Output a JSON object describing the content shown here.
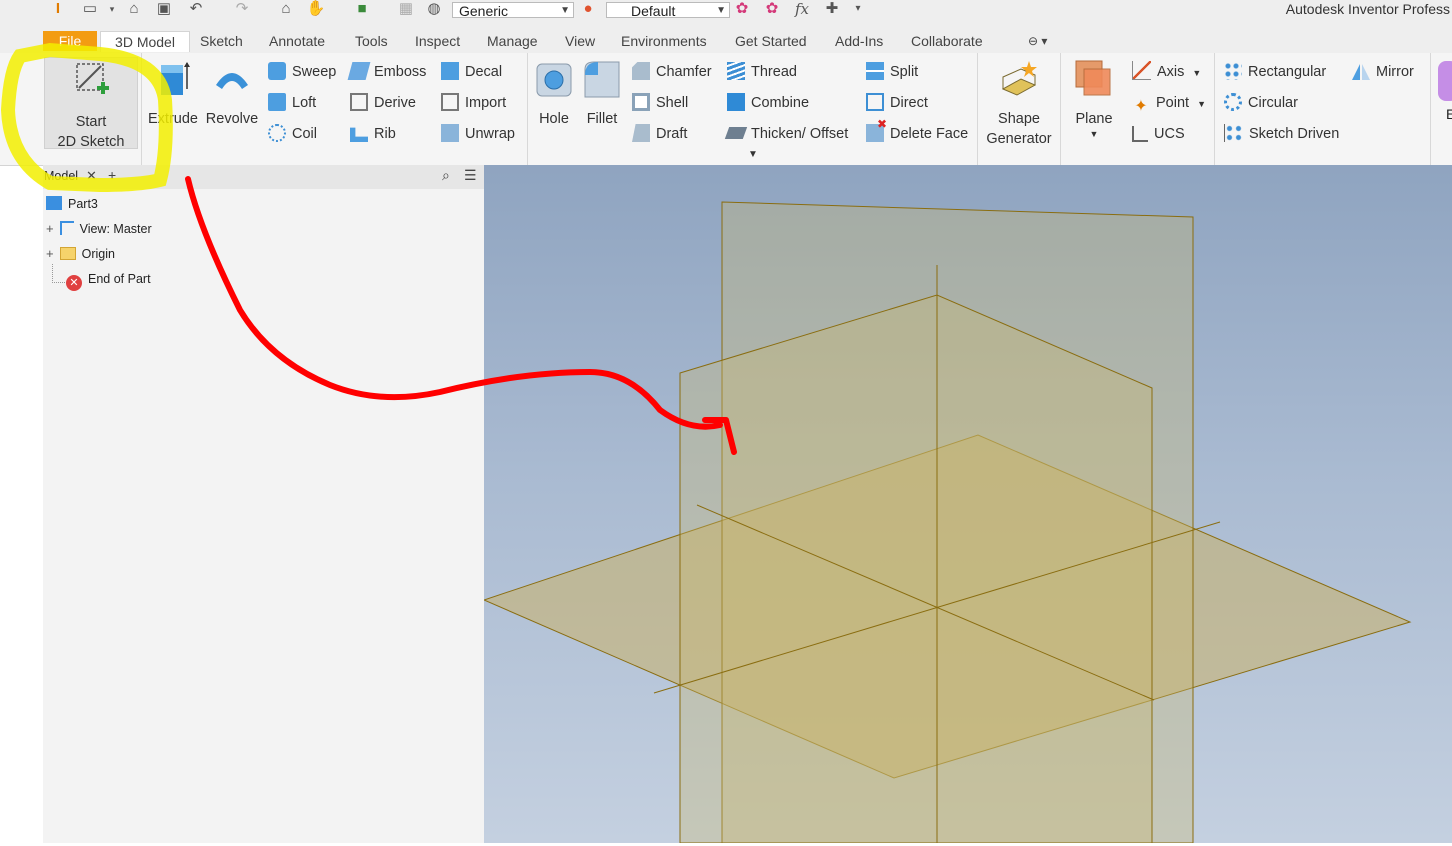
{
  "qat": {
    "material": "Generic",
    "appearance": "Default",
    "fx": "fx"
  },
  "app_title": "Autodesk Inventor Profess",
  "tabs": [
    "File",
    "3D Model",
    "Sketch",
    "Annotate",
    "Tools",
    "Inspect",
    "Manage",
    "View",
    "Environments",
    "Get Started",
    "Add-Ins",
    "Collaborate"
  ],
  "ribbon": {
    "start_sketch": {
      "line1": "Start",
      "line2": "2D Sketch"
    },
    "extrude": "Extrude",
    "revolve": "Revolve",
    "sweep": "Sweep",
    "loft": "Loft",
    "coil": "Coil",
    "emboss": "Emboss",
    "derive": "Derive",
    "rib": "Rib",
    "decal": "Decal",
    "import": "Import",
    "unwrap": "Unwrap",
    "hole": "Hole",
    "fillet": "Fillet",
    "chamfer": "Chamfer",
    "shell": "Shell",
    "draft": "Draft",
    "thread": "Thread",
    "combine": "Combine",
    "thicken": "Thicken/ Offset",
    "split": "Split",
    "direct": "Direct",
    "delete_face": "Delete Face",
    "shape_gen": {
      "line1": "Shape",
      "line2": "Generator"
    },
    "plane": "Plane",
    "axis": "Axis",
    "point": "Point",
    "ucs": "UCS",
    "rectangular": "Rectangular",
    "circular": "Circular",
    "sketch_driven": "Sketch Driven",
    "mirror": "Mirror",
    "cut_letter": "E"
  },
  "browser": {
    "tab": "Model",
    "items": [
      {
        "label": "Part3"
      },
      {
        "label": "View: Master"
      },
      {
        "label": "Origin"
      },
      {
        "label": "End of Part"
      }
    ]
  },
  "colors": {
    "highlight": "#f2ef00",
    "annotation_arrow": "#ff0000",
    "file_tab": "#f39c12",
    "plane_outline": "#8a6d10"
  }
}
